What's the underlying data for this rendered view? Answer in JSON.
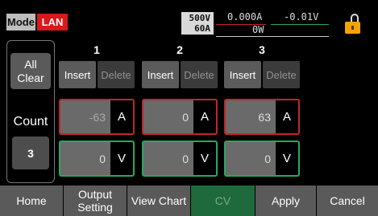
{
  "header": {
    "mode_label": "Mode",
    "interface_label": "LAN",
    "voltage_rating": "500V",
    "current_rating": "60A",
    "measured_current": "0.000A",
    "measured_voltage": "-0.01V",
    "measured_power": "0W",
    "lock_icon": "lock-open-icon"
  },
  "left": {
    "all_clear_label": "All Clear",
    "count_label": "Count",
    "count_value": "3"
  },
  "columns": [
    {
      "number": "1",
      "insert_label": "Insert",
      "delete_label": "Delete",
      "current": "-63",
      "current_unit": "A",
      "voltage": "0",
      "voltage_unit": "V"
    },
    {
      "number": "2",
      "insert_label": "Insert",
      "delete_label": "Delete",
      "current": "0",
      "current_unit": "A",
      "voltage": "0",
      "voltage_unit": "V"
    },
    {
      "number": "3",
      "insert_label": "Insert",
      "delete_label": "Delete",
      "current": "63",
      "current_unit": "A",
      "voltage": "0",
      "voltage_unit": "V"
    }
  ],
  "bottom": {
    "home": "Home",
    "output_setting": "Output Setting",
    "view_chart": "View Chart",
    "cv": "CV",
    "apply": "Apply",
    "cancel": "Cancel"
  },
  "colors": {
    "lan": "#d7191b",
    "current_border": "#c0262b",
    "voltage_border": "#2aa860",
    "cv_active": "#1f6a3c",
    "lock": "#f5a300"
  }
}
